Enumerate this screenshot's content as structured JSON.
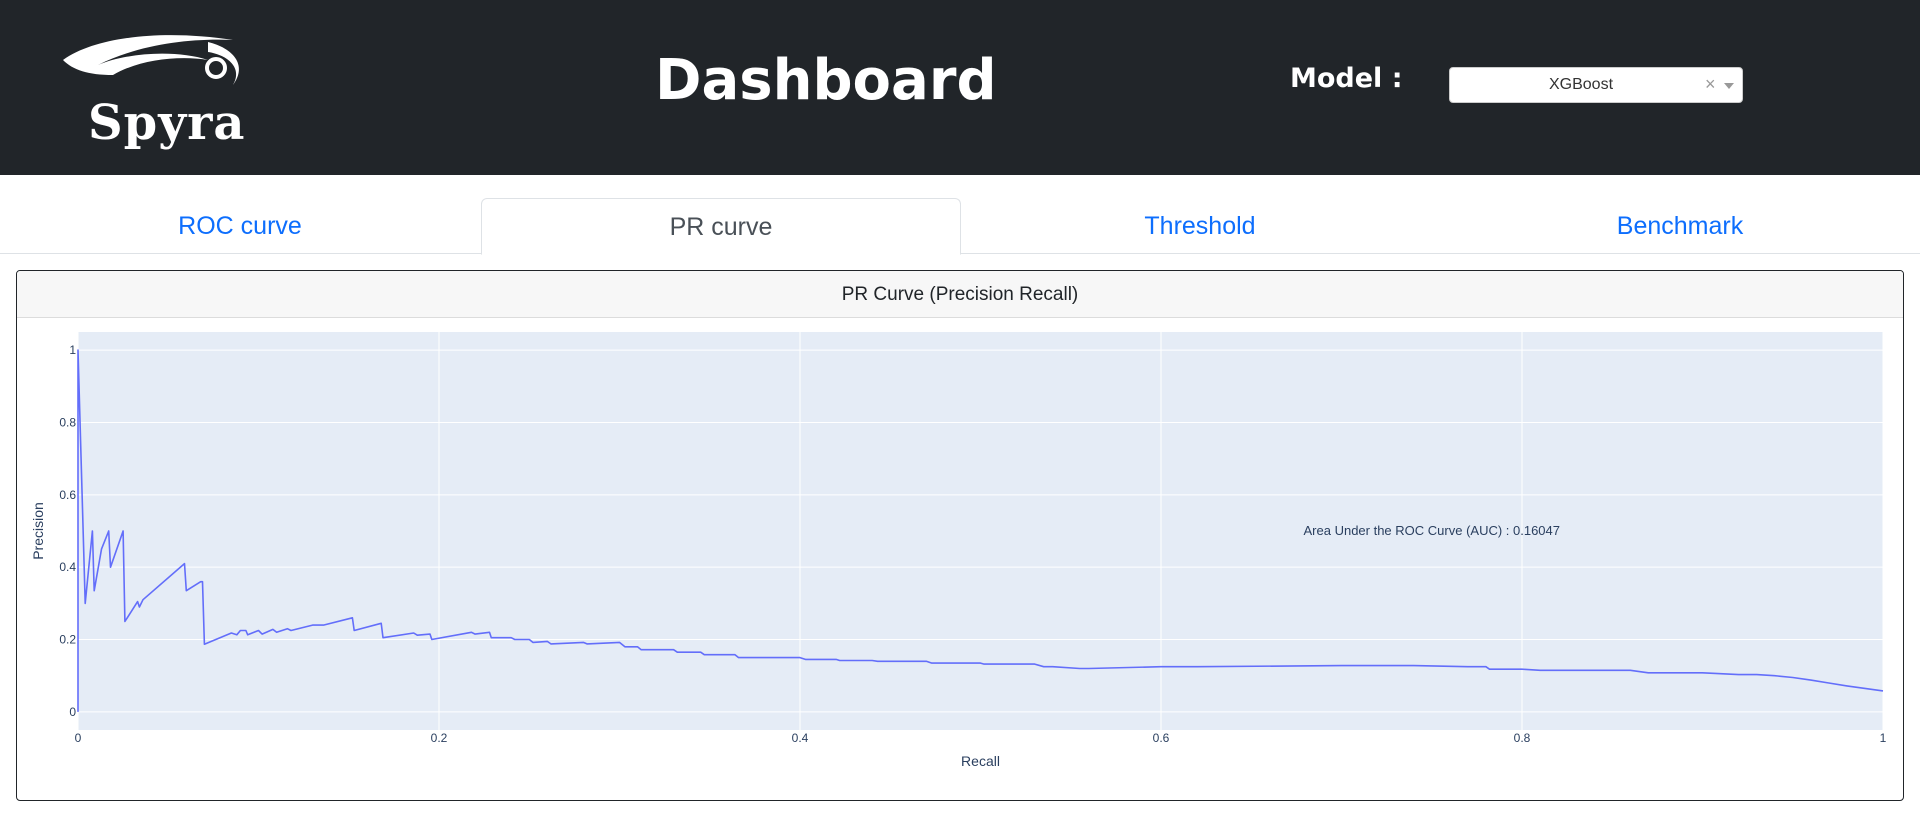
{
  "header": {
    "logo_text": "Spyra",
    "title": "Dashboard",
    "model_label": "Model :",
    "model_select": {
      "value": "XGBoost",
      "clear_symbol": "×"
    }
  },
  "tabs": [
    {
      "label": "ROC curve",
      "active": false
    },
    {
      "label": "PR curve",
      "active": true
    },
    {
      "label": "Threshold",
      "active": false
    },
    {
      "label": "Benchmark",
      "active": false
    }
  ],
  "card": {
    "title": "PR Curve (Precision Recall)"
  },
  "colors": {
    "header_bg": "#212529",
    "link": "#0d6efd",
    "plot_bg": "#e5ecf6",
    "line": "#636efa"
  },
  "chart_data": {
    "type": "line",
    "title": "",
    "xlabel": "Recall",
    "ylabel": "Precision",
    "xlim": [
      0,
      1
    ],
    "ylim": [
      -0.05,
      1.05
    ],
    "xticks": [
      "0",
      "0.2",
      "0.4",
      "0.6",
      "0.8",
      "1"
    ],
    "yticks": [
      "0",
      "0.2",
      "0.4",
      "0.6",
      "0.8",
      "1"
    ],
    "grid": true,
    "legend": "none",
    "annotation": "Area Under the ROC Curve (AUC) : 0.16047",
    "series": [
      {
        "color": "#636efa",
        "x": [
          0,
          0,
          0.004,
          0.008,
          0.009,
          0.013,
          0.017,
          0.018,
          0.025,
          0.026,
          0.033,
          0.034,
          0.036,
          0.059,
          0.06,
          0.068,
          0.069,
          0.07,
          0.085,
          0.088,
          0.09,
          0.093,
          0.094,
          0.1,
          0.102,
          0.108,
          0.11,
          0.116,
          0.118,
          0.13,
          0.136,
          0.152,
          0.153,
          0.168,
          0.169,
          0.186,
          0.188,
          0.195,
          0.196,
          0.218,
          0.22,
          0.228,
          0.229,
          0.24,
          0.242,
          0.25,
          0.252,
          0.26,
          0.262,
          0.28,
          0.282,
          0.3,
          0.303,
          0.31,
          0.312,
          0.33,
          0.332,
          0.345,
          0.347,
          0.364,
          0.366,
          0.4,
          0.403,
          0.42,
          0.422,
          0.44,
          0.443,
          0.47,
          0.473,
          0.5,
          0.502,
          0.53,
          0.535,
          0.54,
          0.555,
          0.56,
          0.6,
          0.62,
          0.7,
          0.74,
          0.77,
          0.78,
          0.782,
          0.8,
          0.81,
          0.86,
          0.87,
          0.9,
          0.92,
          0.93,
          0.94,
          0.95,
          0.96,
          0.97,
          0.98,
          0.99,
          1
        ],
        "y": [
          0,
          1,
          0.3,
          0.5,
          0.335,
          0.45,
          0.5,
          0.4,
          0.5,
          0.25,
          0.305,
          0.29,
          0.31,
          0.41,
          0.335,
          0.36,
          0.36,
          0.187,
          0.218,
          0.213,
          0.225,
          0.225,
          0.213,
          0.225,
          0.215,
          0.228,
          0.22,
          0.23,
          0.225,
          0.24,
          0.24,
          0.26,
          0.225,
          0.245,
          0.205,
          0.218,
          0.212,
          0.215,
          0.2,
          0.22,
          0.215,
          0.22,
          0.205,
          0.205,
          0.2,
          0.2,
          0.192,
          0.195,
          0.188,
          0.192,
          0.188,
          0.192,
          0.18,
          0.18,
          0.172,
          0.172,
          0.165,
          0.165,
          0.158,
          0.158,
          0.15,
          0.15,
          0.145,
          0.145,
          0.142,
          0.142,
          0.14,
          0.14,
          0.135,
          0.135,
          0.132,
          0.132,
          0.125,
          0.125,
          0.12,
          0.12,
          0.125,
          0.125,
          0.128,
          0.128,
          0.125,
          0.125,
          0.118,
          0.118,
          0.115,
          0.115,
          0.108,
          0.108,
          0.103,
          0.103,
          0.1,
          0.095,
          0.088,
          0.08,
          0.072,
          0.065,
          0.058
        ]
      }
    ]
  }
}
